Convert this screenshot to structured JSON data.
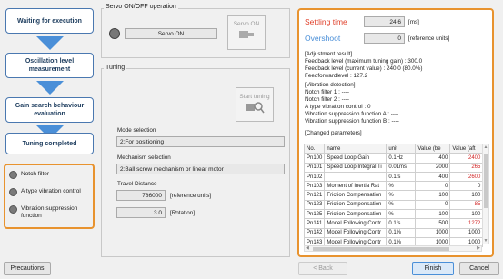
{
  "steps": [
    "Waiting for execution",
    "Oscillation level measurement",
    "Gain search behaviour evaluation",
    "Tuning completed"
  ],
  "legend": [
    "Notch filter",
    "A type vibration control",
    "Vibration suppression function"
  ],
  "servo": {
    "title": "Servo ON/OFF operation",
    "status": "Servo ON",
    "button": "Servo ON"
  },
  "tuning": {
    "title": "Tuning",
    "button": "Start tuning",
    "mode_label": "Mode selection",
    "mode_value": "2:For positioning",
    "mech_label": "Mechanism selection",
    "mech_value": "2:Ball screw mechanism or linear motor",
    "travel_label": "Travel Distance",
    "travel_value": "786000",
    "travel_unit": "[reference units]",
    "rotation_value": "3.0",
    "rotation_unit": "[Rotation]"
  },
  "result": {
    "settling_label": "Settling time",
    "settling_value": "24.6",
    "settling_unit": "[ms]",
    "overshoot_label": "Overshoot",
    "overshoot_value": "0",
    "overshoot_unit": "[reference units]",
    "adj_title": "[Adjustment result]",
    "adj_lines": [
      "Feedback level (maximum tuning gain) : 300.0",
      "Feedback level (current value)    : 240.0 (80.0%)",
      "Feedforwardlevel                  : 127.2"
    ],
    "vib_title": "[Vibration detection]",
    "vib_lines": [
      "Notch filter 1                    : ----",
      "Notch filter 2                    : ----",
      "A type vibration control          :  0",
      "Vibration suppression function A : ----",
      "Vibration suppression function B : ----"
    ],
    "changed_title": "[Changed parameters]",
    "columns": [
      "No.",
      "name",
      "unit",
      "Value (be",
      "Value (aft"
    ],
    "rows": [
      [
        "Pn100",
        "Speed Loop Gain",
        "0.1Hz",
        "400",
        "2400"
      ],
      [
        "Pn101",
        "Speed Loop Integral Ti",
        "0.01ms",
        "2000",
        "265"
      ],
      [
        "Pn102",
        "",
        "0.1/s",
        "400",
        "2600"
      ],
      [
        "Pn103",
        "Moment of Inertia Rat",
        "%",
        "0",
        "0"
      ],
      [
        "Pn121",
        "Friction Compensation",
        "%",
        "100",
        "100"
      ],
      [
        "Pn123",
        "Friction Compensation",
        "%",
        "0",
        "85"
      ],
      [
        "Pn125",
        "Friction Compensation",
        "%",
        "100",
        "100"
      ],
      [
        "Pn141",
        "Model Following Contr",
        "0.1/s",
        "500",
        "1272"
      ],
      [
        "Pn142",
        "Model Following Contr",
        "0.1%",
        "1000",
        "1000"
      ],
      [
        "Pn143",
        "Model Following Contr",
        "0.1%",
        "1000",
        "1000"
      ]
    ],
    "red_rows": [
      0,
      1,
      2,
      5,
      7
    ]
  },
  "footer": {
    "precautions": "Precautions",
    "back": "< Back",
    "finish": "Finish",
    "cancel": "Cancel"
  }
}
